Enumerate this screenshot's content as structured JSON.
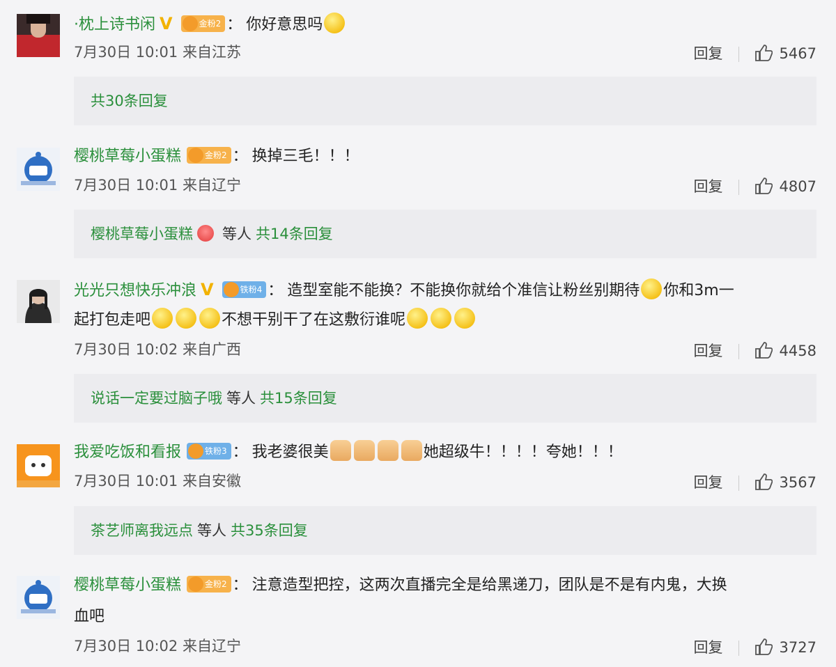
{
  "comments": [
    {
      "username": "·枕上诗书闲",
      "verified_mark": "V",
      "fan_badge": "金粉2",
      "text_parts": [
        "你好意思吗"
      ],
      "time": "7月30日 10:01",
      "location": "来自江苏",
      "reply_label": "回复",
      "likes": "5467",
      "replies_summary": {
        "total": "共30条回复"
      }
    },
    {
      "username": "樱桃草莓小蛋糕",
      "fan_badge": "金粉2",
      "text": "换掉三毛！！！",
      "time": "7月30日 10:01",
      "location": "来自辽宁",
      "reply_label": "回复",
      "likes": "4807",
      "replies_summary": {
        "who": "樱桃草莓小蛋糕",
        "etc": "等人",
        "total": "共14条回复"
      }
    },
    {
      "username": "光光只想快乐冲浪",
      "verified_mark": "V",
      "fan_badge": "铁粉4",
      "line1_a": "造型室能不能换？不能换你就给个准信让粉丝别期待",
      "line1_b": "你和3m一",
      "line2_a": "起打包走吧",
      "line2_b": "不想干别干了在这敷衍谁呢",
      "time": "7月30日 10:02",
      "location": "来自广西",
      "reply_label": "回复",
      "likes": "4458",
      "replies_summary": {
        "who": "说话一定要过脑子哦",
        "etc": "等人",
        "total": "共15条回复"
      }
    },
    {
      "username": "我爱吃饭和看报",
      "fan_badge": "铁粉3",
      "text_a": "我老婆很美",
      "text_b": "她超级牛！！！！夸她！！！",
      "time": "7月30日 10:01",
      "location": "来自安徽",
      "reply_label": "回复",
      "likes": "3567",
      "replies_summary": {
        "who": "茶艺师离我远点",
        "etc": "等人",
        "total": "共35条回复"
      }
    },
    {
      "username": "樱桃草莓小蛋糕",
      "fan_badge": "金粉2",
      "line1": "注意造型把控，这两次直播完全是给黑递刀，团队是不是有内鬼，大换",
      "line2": "血吧",
      "time": "7月30日 10:02",
      "location": "来自辽宁",
      "reply_label": "回复",
      "likes": "3727"
    }
  ],
  "colors": {
    "username": "#2a8f3b",
    "background": "#f4f4f6",
    "reply_box": "#ececef"
  },
  "icons": {
    "verified": "verified-v-icon",
    "like": "thumb-up-icon",
    "emoji": "smile-emoji-icon",
    "thumb_emoji": "thumbs-up-emoji-icon"
  }
}
